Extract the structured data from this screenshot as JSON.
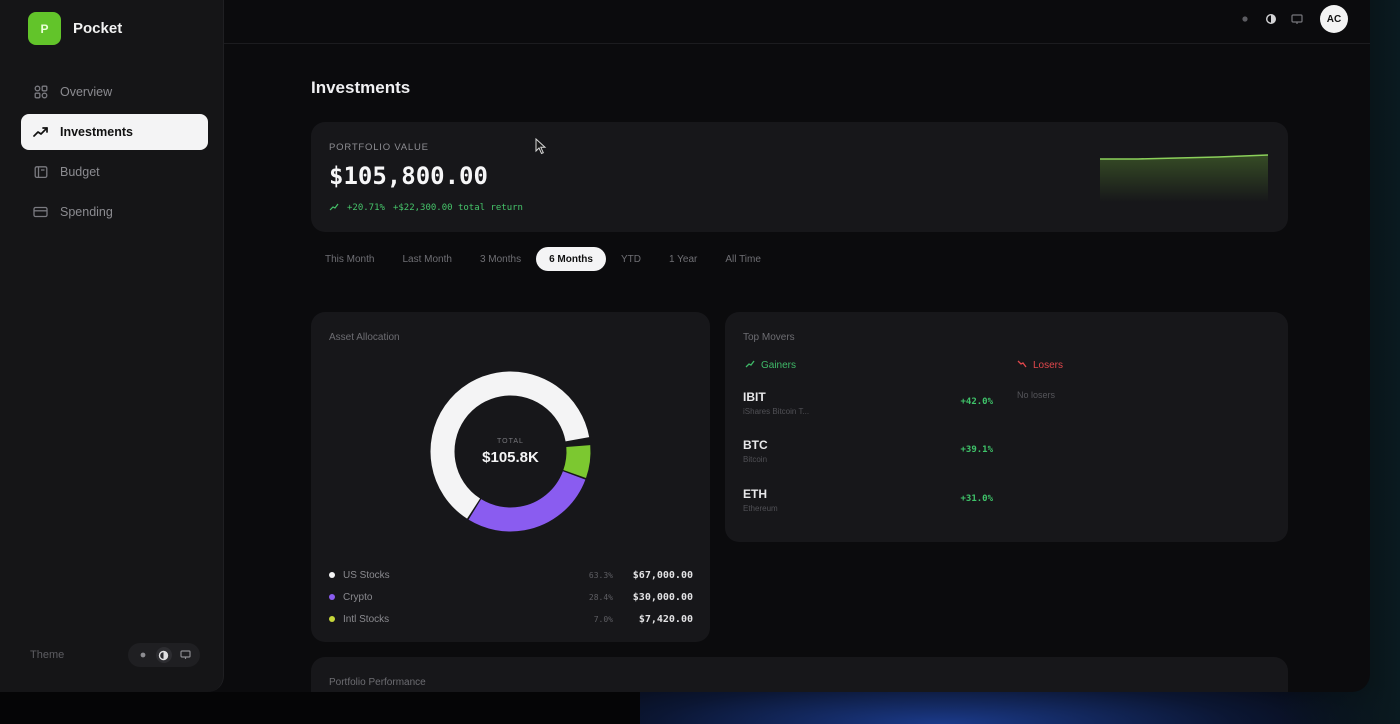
{
  "app": {
    "logo_letter": "P",
    "name": "Pocket"
  },
  "sidebar": {
    "items": [
      {
        "label": "Overview",
        "icon": "grid-icon"
      },
      {
        "label": "Investments",
        "icon": "trending-up-icon"
      },
      {
        "label": "Budget",
        "icon": "wallet-icon"
      },
      {
        "label": "Spending",
        "icon": "credit-card-icon"
      }
    ],
    "active_index": 1,
    "theme_label": "Theme",
    "theme_options": [
      "light-icon",
      "dark-icon",
      "system-icon"
    ]
  },
  "topbar": {
    "icons": [
      "light-icon",
      "dark-icon",
      "monitor-icon"
    ],
    "avatar_initials": "AC"
  },
  "page": {
    "title": "Investments"
  },
  "portfolio": {
    "label": "PORTFOLIO VALUE",
    "value": "$105,800.00",
    "return_pct": "+20.71%",
    "return_amount": "+$22,300.00 total return"
  },
  "range_tabs": {
    "items": [
      "This Month",
      "Last Month",
      "3 Months",
      "6 Months",
      "YTD",
      "1 Year",
      "All Time"
    ],
    "active_index": 3
  },
  "asset_allocation": {
    "title": "Asset Allocation",
    "total_label": "TOTAL",
    "total_value": "$105.8K",
    "items": [
      {
        "name": "US Stocks",
        "pct": "63.3%",
        "value": "$67,000.00",
        "color": "#f4f4f5",
        "share": 0.633
      },
      {
        "name": "Crypto",
        "pct": "28.4%",
        "value": "$30,000.00",
        "color": "#8a5cf0",
        "share": 0.284
      },
      {
        "name": "Intl Stocks",
        "pct": "7.0%",
        "value": "$7,420.00",
        "color": "#7cc830",
        "share": 0.07
      }
    ]
  },
  "top_movers": {
    "title": "Top Movers",
    "gainers_label": "Gainers",
    "losers_label": "Losers",
    "no_losers": "No losers",
    "gainers": [
      {
        "symbol": "IBIT",
        "name": "iShares Bitcoin T...",
        "change": "+42.0%"
      },
      {
        "symbol": "BTC",
        "name": "Bitcoin",
        "change": "+39.1%"
      },
      {
        "symbol": "ETH",
        "name": "Ethereum",
        "change": "+31.0%"
      }
    ]
  },
  "performance": {
    "title": "Portfolio Performance"
  }
}
